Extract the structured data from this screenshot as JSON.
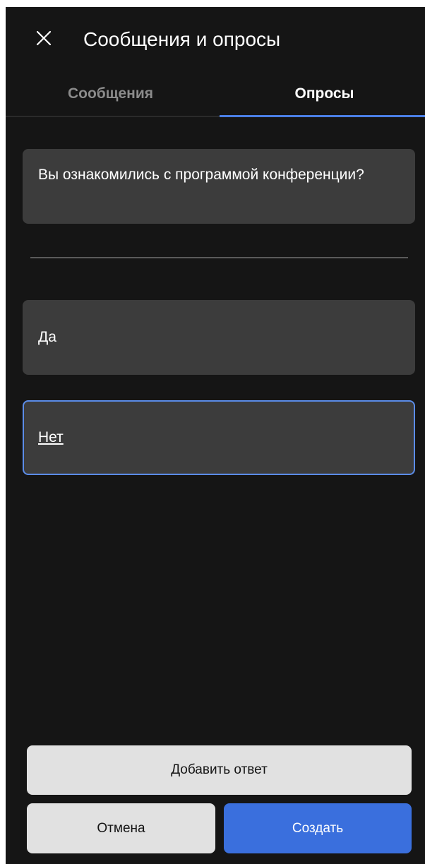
{
  "header": {
    "title": "Сообщения и опросы",
    "close_icon": "close-icon"
  },
  "tabs": [
    {
      "label": "Сообщения",
      "active": false
    },
    {
      "label": "Опросы",
      "active": true
    }
  ],
  "poll": {
    "question": "Вы ознакомились с программой конференции?",
    "answers": [
      {
        "value": "Да",
        "focused": false
      },
      {
        "value": "Нет",
        "focused": true
      }
    ]
  },
  "actions": {
    "add_answer_label": "Добавить ответ",
    "cancel_label": "Отмена",
    "create_label": "Создать"
  },
  "colors": {
    "background": "#151515",
    "card": "#3c3c3c",
    "accent": "#3a6fdd",
    "focus_border": "#5b8ce8",
    "secondary_button": "#e1e1e1"
  }
}
